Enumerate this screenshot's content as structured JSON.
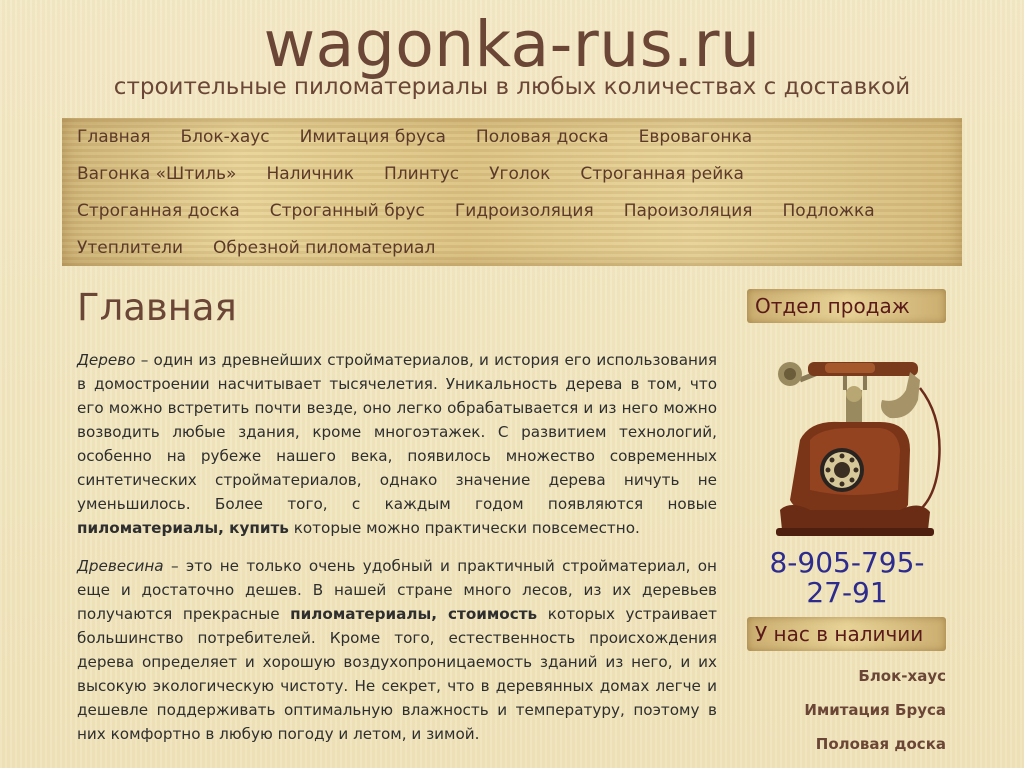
{
  "header": {
    "site_title": "wagonka-rus.ru",
    "tagline": "строительные пиломатериалы в любых количествах с доставкой"
  },
  "nav": {
    "rows": [
      [
        "Главная",
        "Блок-хаус",
        "Имитация бруса",
        "Половая доска",
        "Евровагонка"
      ],
      [
        "Вагонка «Штиль»",
        "Наличник",
        "Плинтус",
        "Уголок",
        "Строганная рейка"
      ],
      [
        "Строганная доска",
        "Строганный брус",
        "Гидроизоляция",
        "Пароизоляция",
        "Подложка"
      ],
      [
        "Утеплители",
        "Обрезной пиломатериал"
      ]
    ]
  },
  "main": {
    "title": "Главная",
    "p1": {
      "lead_italic": "Дерево",
      "text1": " – один из древнейших стройматериалов, и история его использования в домостроении насчитывает тысячелетия. Уникальность дерева в том, что его можно встретить почти везде, оно легко обрабатывается и из него можно возводить любые здания, кроме многоэтажек. С развитием технологий, особенно на рубеже нашего века, появилось множество современных синтетических стройматериалов, однако значение дерева ничуть не уменьшилось. Более того, с каждым годом появляются новые ",
      "bold": "пиломатериалы, купить",
      "text2": " которые можно практически повсеместно."
    },
    "p2": {
      "lead_italic": "Древесина",
      "text1": " – это не только очень удобный и практичный стройматериал, он еще и достаточно дешев. В нашей стране много лесов, из их деревьев получаются прекрасные ",
      "bold": "пиломатериалы, стоимость",
      "text2": " которых устраивает большинство потребителей. Кроме того, естественность происхождения дерева определяет и хорошую воздухопроницаемость зданий из него, и их высокую экологическую чистоту. Не секрет, что в деревянных домах легче и дешевле поддерживать оптимальную влажность и температуру, поэтому в них комфортно в любую погоду и летом, и зимой."
    }
  },
  "sidebar": {
    "sales_title": "Отдел продаж",
    "phone_line1": "8-905-795-",
    "phone_line2": "27-91",
    "stock_title": "У нас в наличии",
    "stock_links": [
      "Блок-хаус",
      "Имитация Бруса",
      "Половая доска"
    ]
  },
  "colors": {
    "accent_brown": "#6b4636",
    "phone_blue": "#2d2b8e",
    "widget_title": "#5a1a1a"
  },
  "icons": {
    "phone_image": "antique-telephone-icon"
  }
}
